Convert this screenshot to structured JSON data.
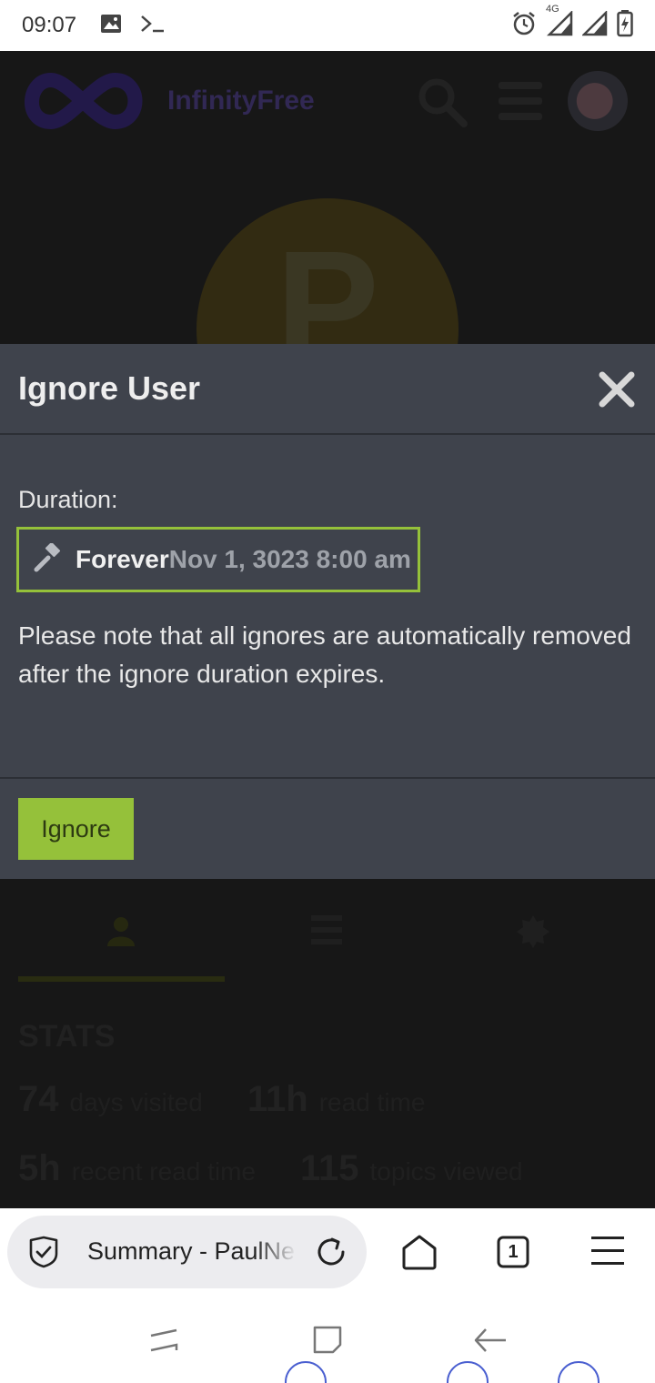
{
  "status_bar": {
    "time": "09:07",
    "left_icons": [
      "image-icon",
      "terminal-icon"
    ],
    "right_icons": [
      "alarm-icon",
      "signal-4g-icon",
      "signal-icon",
      "battery-charging-icon"
    ],
    "network_label": "4G"
  },
  "page": {
    "brand": "InfinityFree",
    "avatar_letter": "P",
    "stats_title": "STATS",
    "stats": [
      {
        "value": "74",
        "label": "days visited"
      },
      {
        "value": "11h",
        "label": "read time"
      },
      {
        "value": "5h",
        "label": "recent read time"
      },
      {
        "value": "115",
        "label": "topics viewed"
      }
    ]
  },
  "modal": {
    "title": "Ignore User",
    "duration_label": "Duration:",
    "duration_value": "Forever",
    "duration_date": "Nov 1, 3023 8:00 am",
    "note": "Please note that all ignores are automatically removed after the ignore duration expires.",
    "ignore_button": "Ignore"
  },
  "browser": {
    "url_text": "Summary - PaulNe",
    "tab_count": "1"
  },
  "colors": {
    "accent": "#95c13a",
    "modal_bg": "#3f434c",
    "page_bg": "#2a2a2a"
  }
}
